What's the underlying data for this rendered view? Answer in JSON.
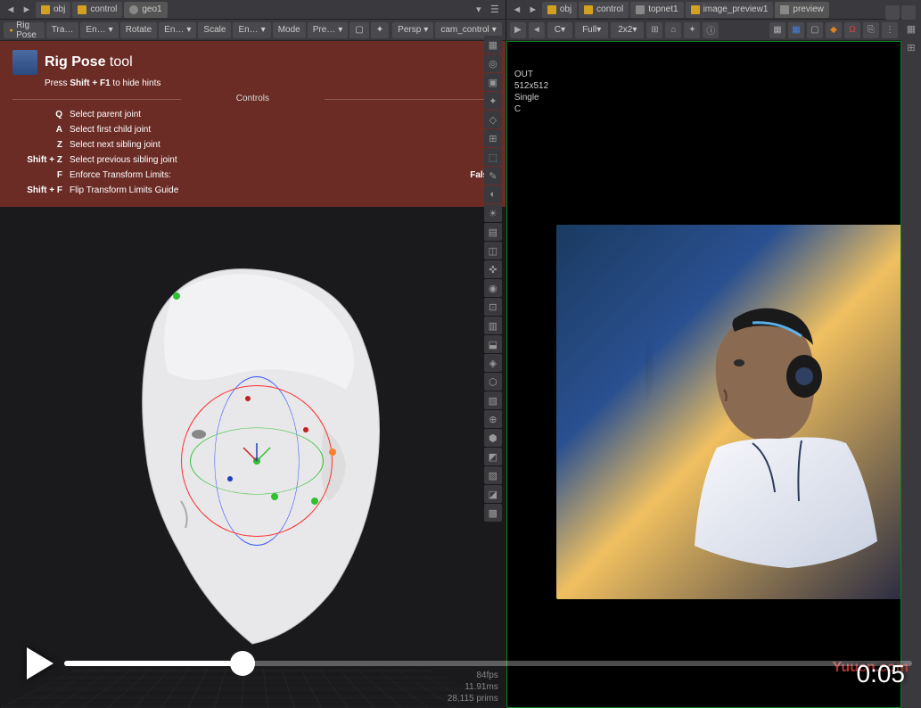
{
  "left_pane": {
    "nav_tabs": [
      {
        "label": "obj",
        "icon": "box"
      },
      {
        "label": "control",
        "icon": "box"
      },
      {
        "label": "geo1",
        "icon": "gear"
      }
    ],
    "toolbar": {
      "tool_label": "Rig Pose",
      "btn_tra": "Tra…",
      "btn_en1": "En…",
      "btn_rotate": "Rotate",
      "btn_en2": "En…",
      "btn_scale": "Scale",
      "btn_en3": "En…",
      "btn_mode": "Mode",
      "btn_pre": "Pre…",
      "persp": "Persp",
      "cam": "cam_control"
    },
    "rigpose": {
      "title_bold": "Rig Pose",
      "title_light": "tool",
      "hint_pre": "Press",
      "hint_key": "Shift + F1",
      "hint_post": "to hide hints",
      "controls_label": "Controls",
      "shortcuts": [
        {
          "key": "Q",
          "desc": "Select parent joint"
        },
        {
          "key": "A",
          "desc": "Select first child joint"
        },
        {
          "key": "Z",
          "desc": "Select next sibling joint"
        },
        {
          "key": "Shift + Z",
          "desc": "Select previous sibling joint"
        },
        {
          "key": "F",
          "desc": "Enforce Transform Limits:",
          "val": "False"
        },
        {
          "key": "Shift + F",
          "desc": "Flip Transform Limits Guide"
        }
      ]
    },
    "bottom_stats": {
      "fps": "84fps",
      "ms": "11.91ms",
      "prims": "28,115 prims"
    }
  },
  "right_pane": {
    "nav_tabs": [
      {
        "label": "obj",
        "icon": "box"
      },
      {
        "label": "control",
        "icon": "box"
      },
      {
        "label": "topnet1",
        "icon": "net"
      },
      {
        "label": "image_preview1",
        "icon": "box"
      },
      {
        "label": "preview",
        "icon": "net"
      }
    ],
    "render_toolbar": {
      "channel": "C",
      "fit": "Full",
      "grid": "2x2"
    },
    "render_info": {
      "line1": "OUT",
      "line2": "512x512",
      "line3": "Single",
      "line4": "C"
    }
  },
  "video": {
    "time": "0:05"
  },
  "watermark": "Yuucn.com"
}
